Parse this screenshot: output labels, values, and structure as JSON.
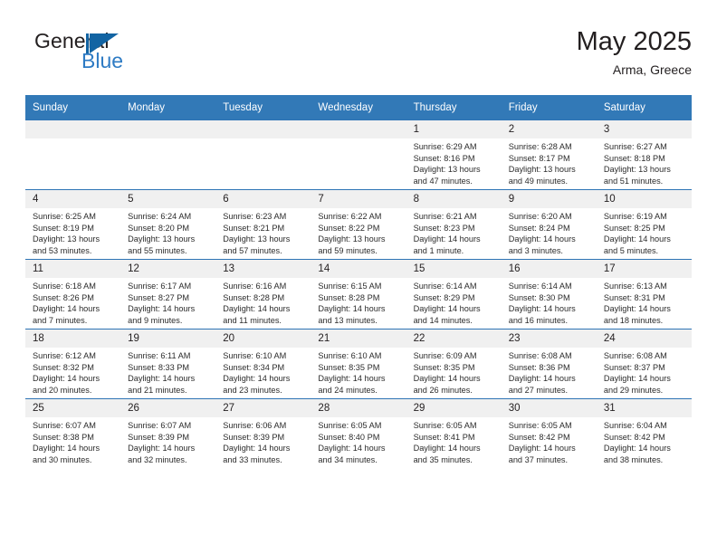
{
  "brand": {
    "word_one": "General",
    "word_two": "Blue",
    "logo_icon": "sail-flag-icon"
  },
  "header": {
    "title": "May 2025",
    "location": "Arma, Greece"
  },
  "calendar": {
    "weekdays": [
      "Sunday",
      "Monday",
      "Tuesday",
      "Wednesday",
      "Thursday",
      "Friday",
      "Saturday"
    ],
    "header_bg": "#3279b7",
    "daynum_bg": "#f0f0f0",
    "row_divider": "#2e74b5",
    "weeks": [
      [
        {
          "day": "",
          "lines": []
        },
        {
          "day": "",
          "lines": []
        },
        {
          "day": "",
          "lines": []
        },
        {
          "day": "",
          "lines": []
        },
        {
          "day": "1",
          "lines": [
            "Sunrise: 6:29 AM",
            "Sunset: 8:16 PM",
            "Daylight: 13 hours",
            "and 47 minutes."
          ]
        },
        {
          "day": "2",
          "lines": [
            "Sunrise: 6:28 AM",
            "Sunset: 8:17 PM",
            "Daylight: 13 hours",
            "and 49 minutes."
          ]
        },
        {
          "day": "3",
          "lines": [
            "Sunrise: 6:27 AM",
            "Sunset: 8:18 PM",
            "Daylight: 13 hours",
            "and 51 minutes."
          ]
        }
      ],
      [
        {
          "day": "4",
          "lines": [
            "Sunrise: 6:25 AM",
            "Sunset: 8:19 PM",
            "Daylight: 13 hours",
            "and 53 minutes."
          ]
        },
        {
          "day": "5",
          "lines": [
            "Sunrise: 6:24 AM",
            "Sunset: 8:20 PM",
            "Daylight: 13 hours",
            "and 55 minutes."
          ]
        },
        {
          "day": "6",
          "lines": [
            "Sunrise: 6:23 AM",
            "Sunset: 8:21 PM",
            "Daylight: 13 hours",
            "and 57 minutes."
          ]
        },
        {
          "day": "7",
          "lines": [
            "Sunrise: 6:22 AM",
            "Sunset: 8:22 PM",
            "Daylight: 13 hours",
            "and 59 minutes."
          ]
        },
        {
          "day": "8",
          "lines": [
            "Sunrise: 6:21 AM",
            "Sunset: 8:23 PM",
            "Daylight: 14 hours",
            "and 1 minute."
          ]
        },
        {
          "day": "9",
          "lines": [
            "Sunrise: 6:20 AM",
            "Sunset: 8:24 PM",
            "Daylight: 14 hours",
            "and 3 minutes."
          ]
        },
        {
          "day": "10",
          "lines": [
            "Sunrise: 6:19 AM",
            "Sunset: 8:25 PM",
            "Daylight: 14 hours",
            "and 5 minutes."
          ]
        }
      ],
      [
        {
          "day": "11",
          "lines": [
            "Sunrise: 6:18 AM",
            "Sunset: 8:26 PM",
            "Daylight: 14 hours",
            "and 7 minutes."
          ]
        },
        {
          "day": "12",
          "lines": [
            "Sunrise: 6:17 AM",
            "Sunset: 8:27 PM",
            "Daylight: 14 hours",
            "and 9 minutes."
          ]
        },
        {
          "day": "13",
          "lines": [
            "Sunrise: 6:16 AM",
            "Sunset: 8:28 PM",
            "Daylight: 14 hours",
            "and 11 minutes."
          ]
        },
        {
          "day": "14",
          "lines": [
            "Sunrise: 6:15 AM",
            "Sunset: 8:28 PM",
            "Daylight: 14 hours",
            "and 13 minutes."
          ]
        },
        {
          "day": "15",
          "lines": [
            "Sunrise: 6:14 AM",
            "Sunset: 8:29 PM",
            "Daylight: 14 hours",
            "and 14 minutes."
          ]
        },
        {
          "day": "16",
          "lines": [
            "Sunrise: 6:14 AM",
            "Sunset: 8:30 PM",
            "Daylight: 14 hours",
            "and 16 minutes."
          ]
        },
        {
          "day": "17",
          "lines": [
            "Sunrise: 6:13 AM",
            "Sunset: 8:31 PM",
            "Daylight: 14 hours",
            "and 18 minutes."
          ]
        }
      ],
      [
        {
          "day": "18",
          "lines": [
            "Sunrise: 6:12 AM",
            "Sunset: 8:32 PM",
            "Daylight: 14 hours",
            "and 20 minutes."
          ]
        },
        {
          "day": "19",
          "lines": [
            "Sunrise: 6:11 AM",
            "Sunset: 8:33 PM",
            "Daylight: 14 hours",
            "and 21 minutes."
          ]
        },
        {
          "day": "20",
          "lines": [
            "Sunrise: 6:10 AM",
            "Sunset: 8:34 PM",
            "Daylight: 14 hours",
            "and 23 minutes."
          ]
        },
        {
          "day": "21",
          "lines": [
            "Sunrise: 6:10 AM",
            "Sunset: 8:35 PM",
            "Daylight: 14 hours",
            "and 24 minutes."
          ]
        },
        {
          "day": "22",
          "lines": [
            "Sunrise: 6:09 AM",
            "Sunset: 8:35 PM",
            "Daylight: 14 hours",
            "and 26 minutes."
          ]
        },
        {
          "day": "23",
          "lines": [
            "Sunrise: 6:08 AM",
            "Sunset: 8:36 PM",
            "Daylight: 14 hours",
            "and 27 minutes."
          ]
        },
        {
          "day": "24",
          "lines": [
            "Sunrise: 6:08 AM",
            "Sunset: 8:37 PM",
            "Daylight: 14 hours",
            "and 29 minutes."
          ]
        }
      ],
      [
        {
          "day": "25",
          "lines": [
            "Sunrise: 6:07 AM",
            "Sunset: 8:38 PM",
            "Daylight: 14 hours",
            "and 30 minutes."
          ]
        },
        {
          "day": "26",
          "lines": [
            "Sunrise: 6:07 AM",
            "Sunset: 8:39 PM",
            "Daylight: 14 hours",
            "and 32 minutes."
          ]
        },
        {
          "day": "27",
          "lines": [
            "Sunrise: 6:06 AM",
            "Sunset: 8:39 PM",
            "Daylight: 14 hours",
            "and 33 minutes."
          ]
        },
        {
          "day": "28",
          "lines": [
            "Sunrise: 6:05 AM",
            "Sunset: 8:40 PM",
            "Daylight: 14 hours",
            "and 34 minutes."
          ]
        },
        {
          "day": "29",
          "lines": [
            "Sunrise: 6:05 AM",
            "Sunset: 8:41 PM",
            "Daylight: 14 hours",
            "and 35 minutes."
          ]
        },
        {
          "day": "30",
          "lines": [
            "Sunrise: 6:05 AM",
            "Sunset: 8:42 PM",
            "Daylight: 14 hours",
            "and 37 minutes."
          ]
        },
        {
          "day": "31",
          "lines": [
            "Sunrise: 6:04 AM",
            "Sunset: 8:42 PM",
            "Daylight: 14 hours",
            "and 38 minutes."
          ]
        }
      ]
    ]
  }
}
